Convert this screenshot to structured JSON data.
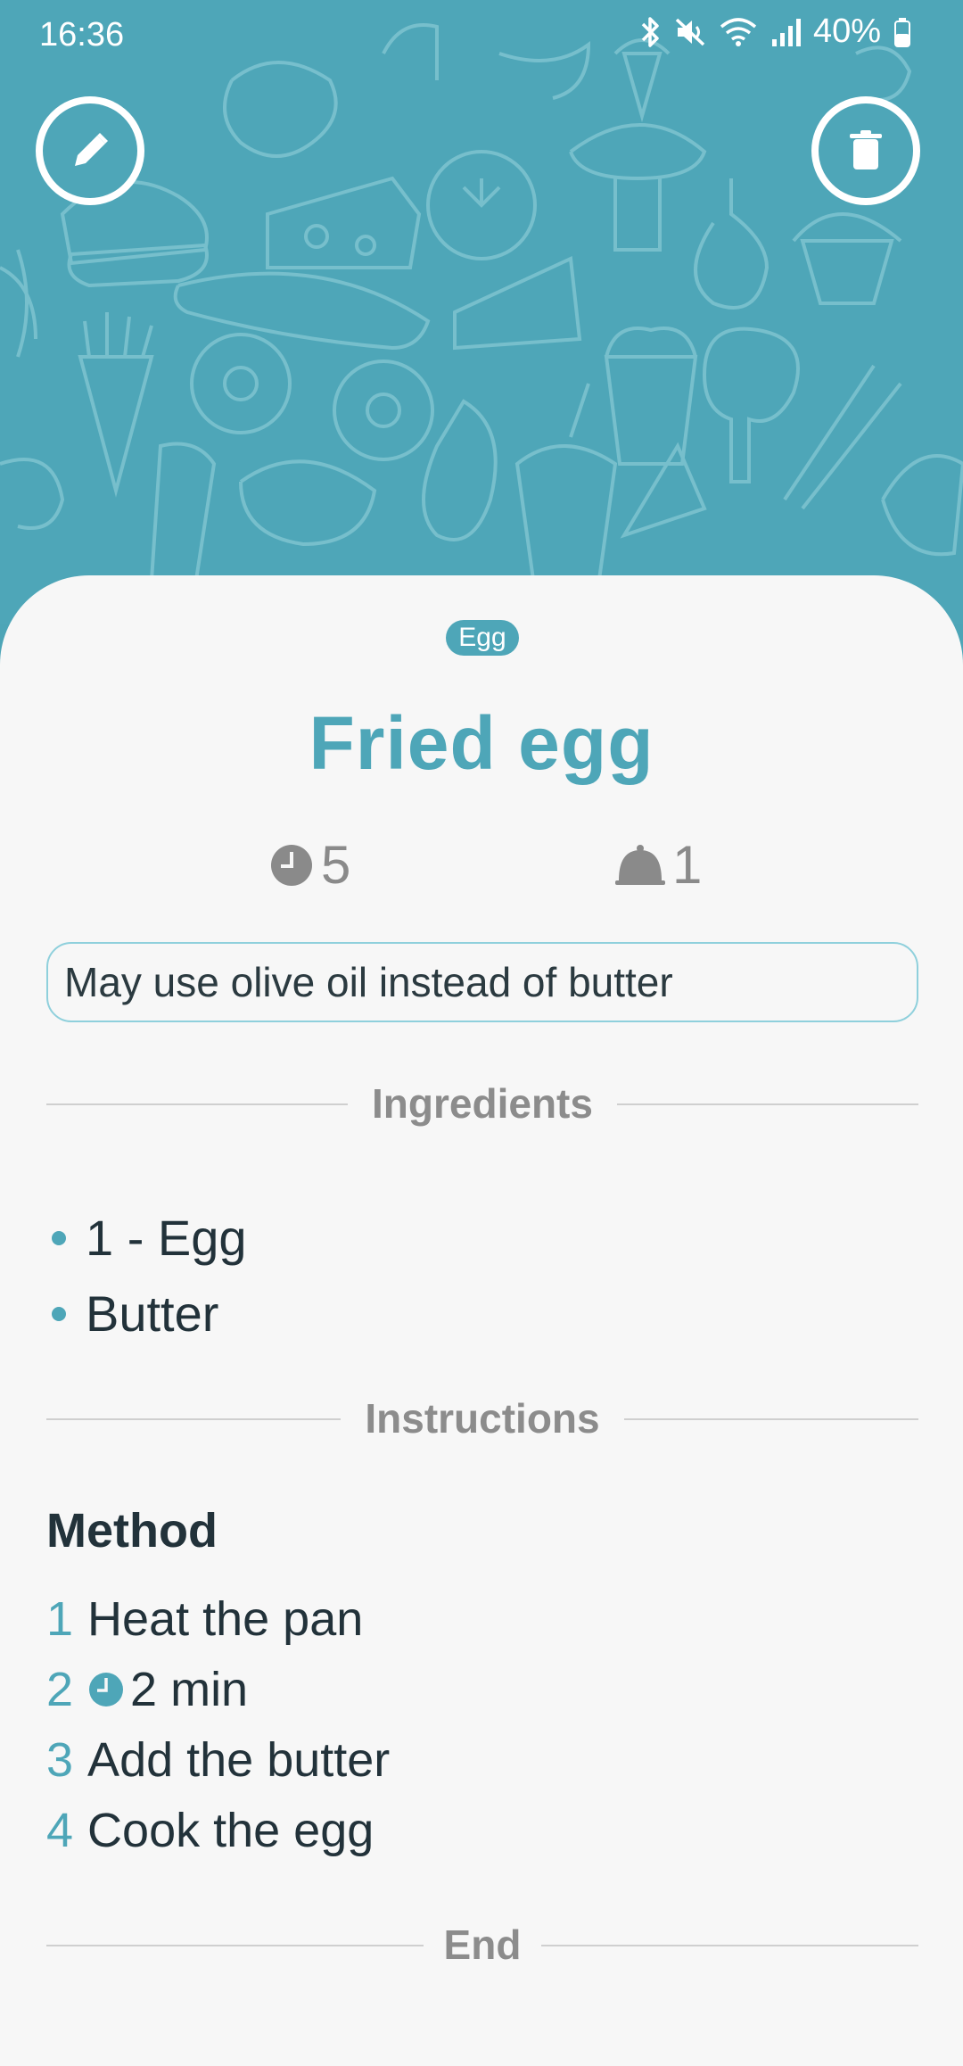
{
  "status_bar": {
    "time": "16:36",
    "battery": "40%",
    "icons": [
      "bluetooth-icon",
      "mute-icon",
      "wifi-icon",
      "signal-icon",
      "battery-icon"
    ]
  },
  "header": {
    "edit_icon": "pencil-icon",
    "delete_icon": "trash-icon",
    "background": "food-doodle-pattern"
  },
  "recipe": {
    "category": "Egg",
    "title": "Fried egg",
    "time": "5",
    "servings": "1",
    "note": "May use olive oil instead of butter"
  },
  "sections": {
    "ingredients": "Ingredients",
    "instructions": "Instructions",
    "end": "End"
  },
  "ingredients": [
    {
      "text": "1 - Egg"
    },
    {
      "text": "Butter"
    }
  ],
  "method": {
    "title": "Method",
    "steps": [
      {
        "num": "1",
        "text": "Heat the pan"
      },
      {
        "num": "2",
        "text": "2 min"
      },
      {
        "num": "3",
        "text": "Add the butter"
      },
      {
        "num": "4",
        "text": "Cook the egg"
      }
    ]
  },
  "colors": {
    "accent": "#4ea6b8",
    "sheet": "#f7f7f7",
    "text": "#22323a",
    "muted": "#8c8c8c"
  }
}
